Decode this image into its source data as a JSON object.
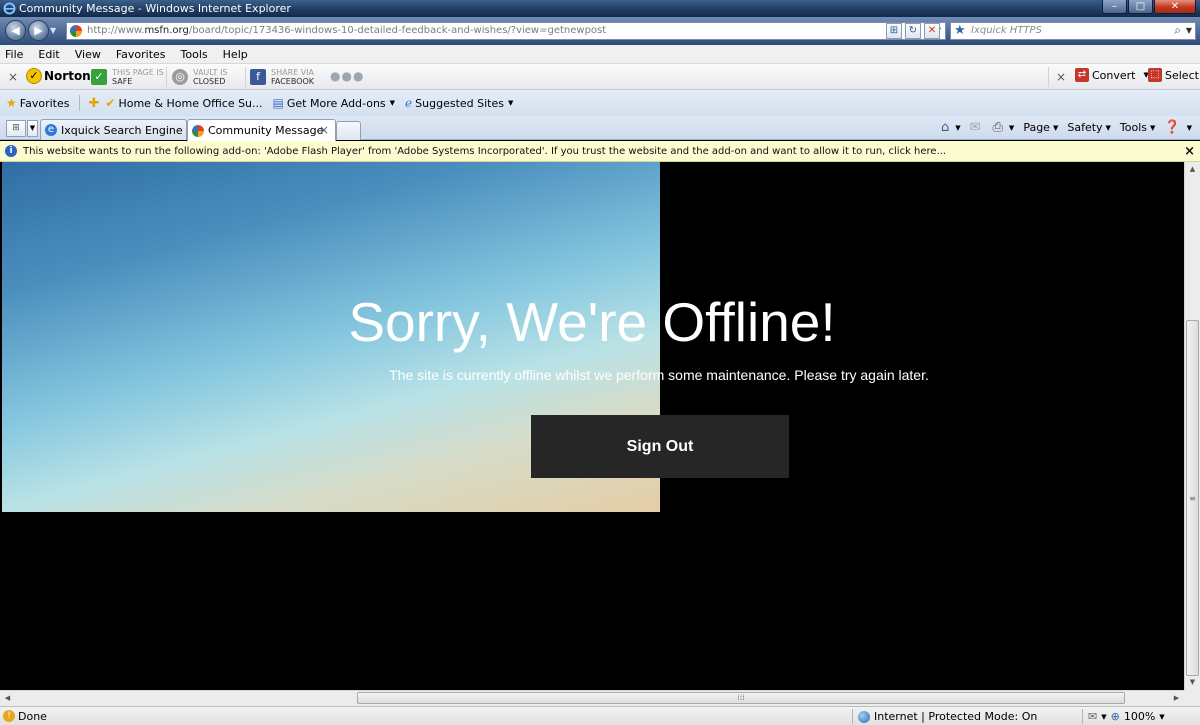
{
  "window": {
    "title": "Community Message - Windows Internet Explorer",
    "controls": {
      "minimize": "–",
      "maximize": "□",
      "close": "✕"
    }
  },
  "address": {
    "url_prefix": "http://www.",
    "url_domain": "msfn.org",
    "url_path": "/board/topic/173436-windows-10-detailed-feedback-and-wishes/?view=getnewpost",
    "search_placeholder": "Ixquick HTTPS"
  },
  "menu": [
    "File",
    "Edit",
    "View",
    "Favorites",
    "Tools",
    "Help"
  ],
  "norton": {
    "brand": "Norton",
    "safe_top": "THIS PAGE IS",
    "safe_bottom": "SAFE",
    "vault_top": "VAULT IS",
    "vault_bottom": "CLOSED",
    "share_top": "SHARE VIA",
    "share_bottom": "FACEBOOK",
    "convert": "Convert",
    "select": "Select"
  },
  "favorites": {
    "label": "Favorites",
    "items": [
      "Home & Home Office Su...",
      "Get More Add-ons",
      "Suggested Sites"
    ]
  },
  "tabs": [
    {
      "label": "Ixquick Search Engine",
      "active": false
    },
    {
      "label": "Community Message",
      "active": true
    }
  ],
  "commands": {
    "page": "Page",
    "safety": "Safety",
    "tools": "Tools"
  },
  "infobar": {
    "message": "This website wants to run the following add-on: 'Adobe Flash Player' from 'Adobe Systems Incorporated'. If you trust the website and the add-on and want to allow it to run, click here..."
  },
  "page": {
    "title": "Sorry, We're Offline!",
    "subtitle": "The site is currently offline whilst we perform some maintenance. Please try again later.",
    "button": "Sign Out"
  },
  "status": {
    "text": "Done",
    "zone": "Internet | Protected Mode: On",
    "zoom": "100%"
  },
  "colors": {
    "accent": "#2f63b3",
    "button_bg": "#262626",
    "infobar_bg": "#fdfbd0"
  }
}
